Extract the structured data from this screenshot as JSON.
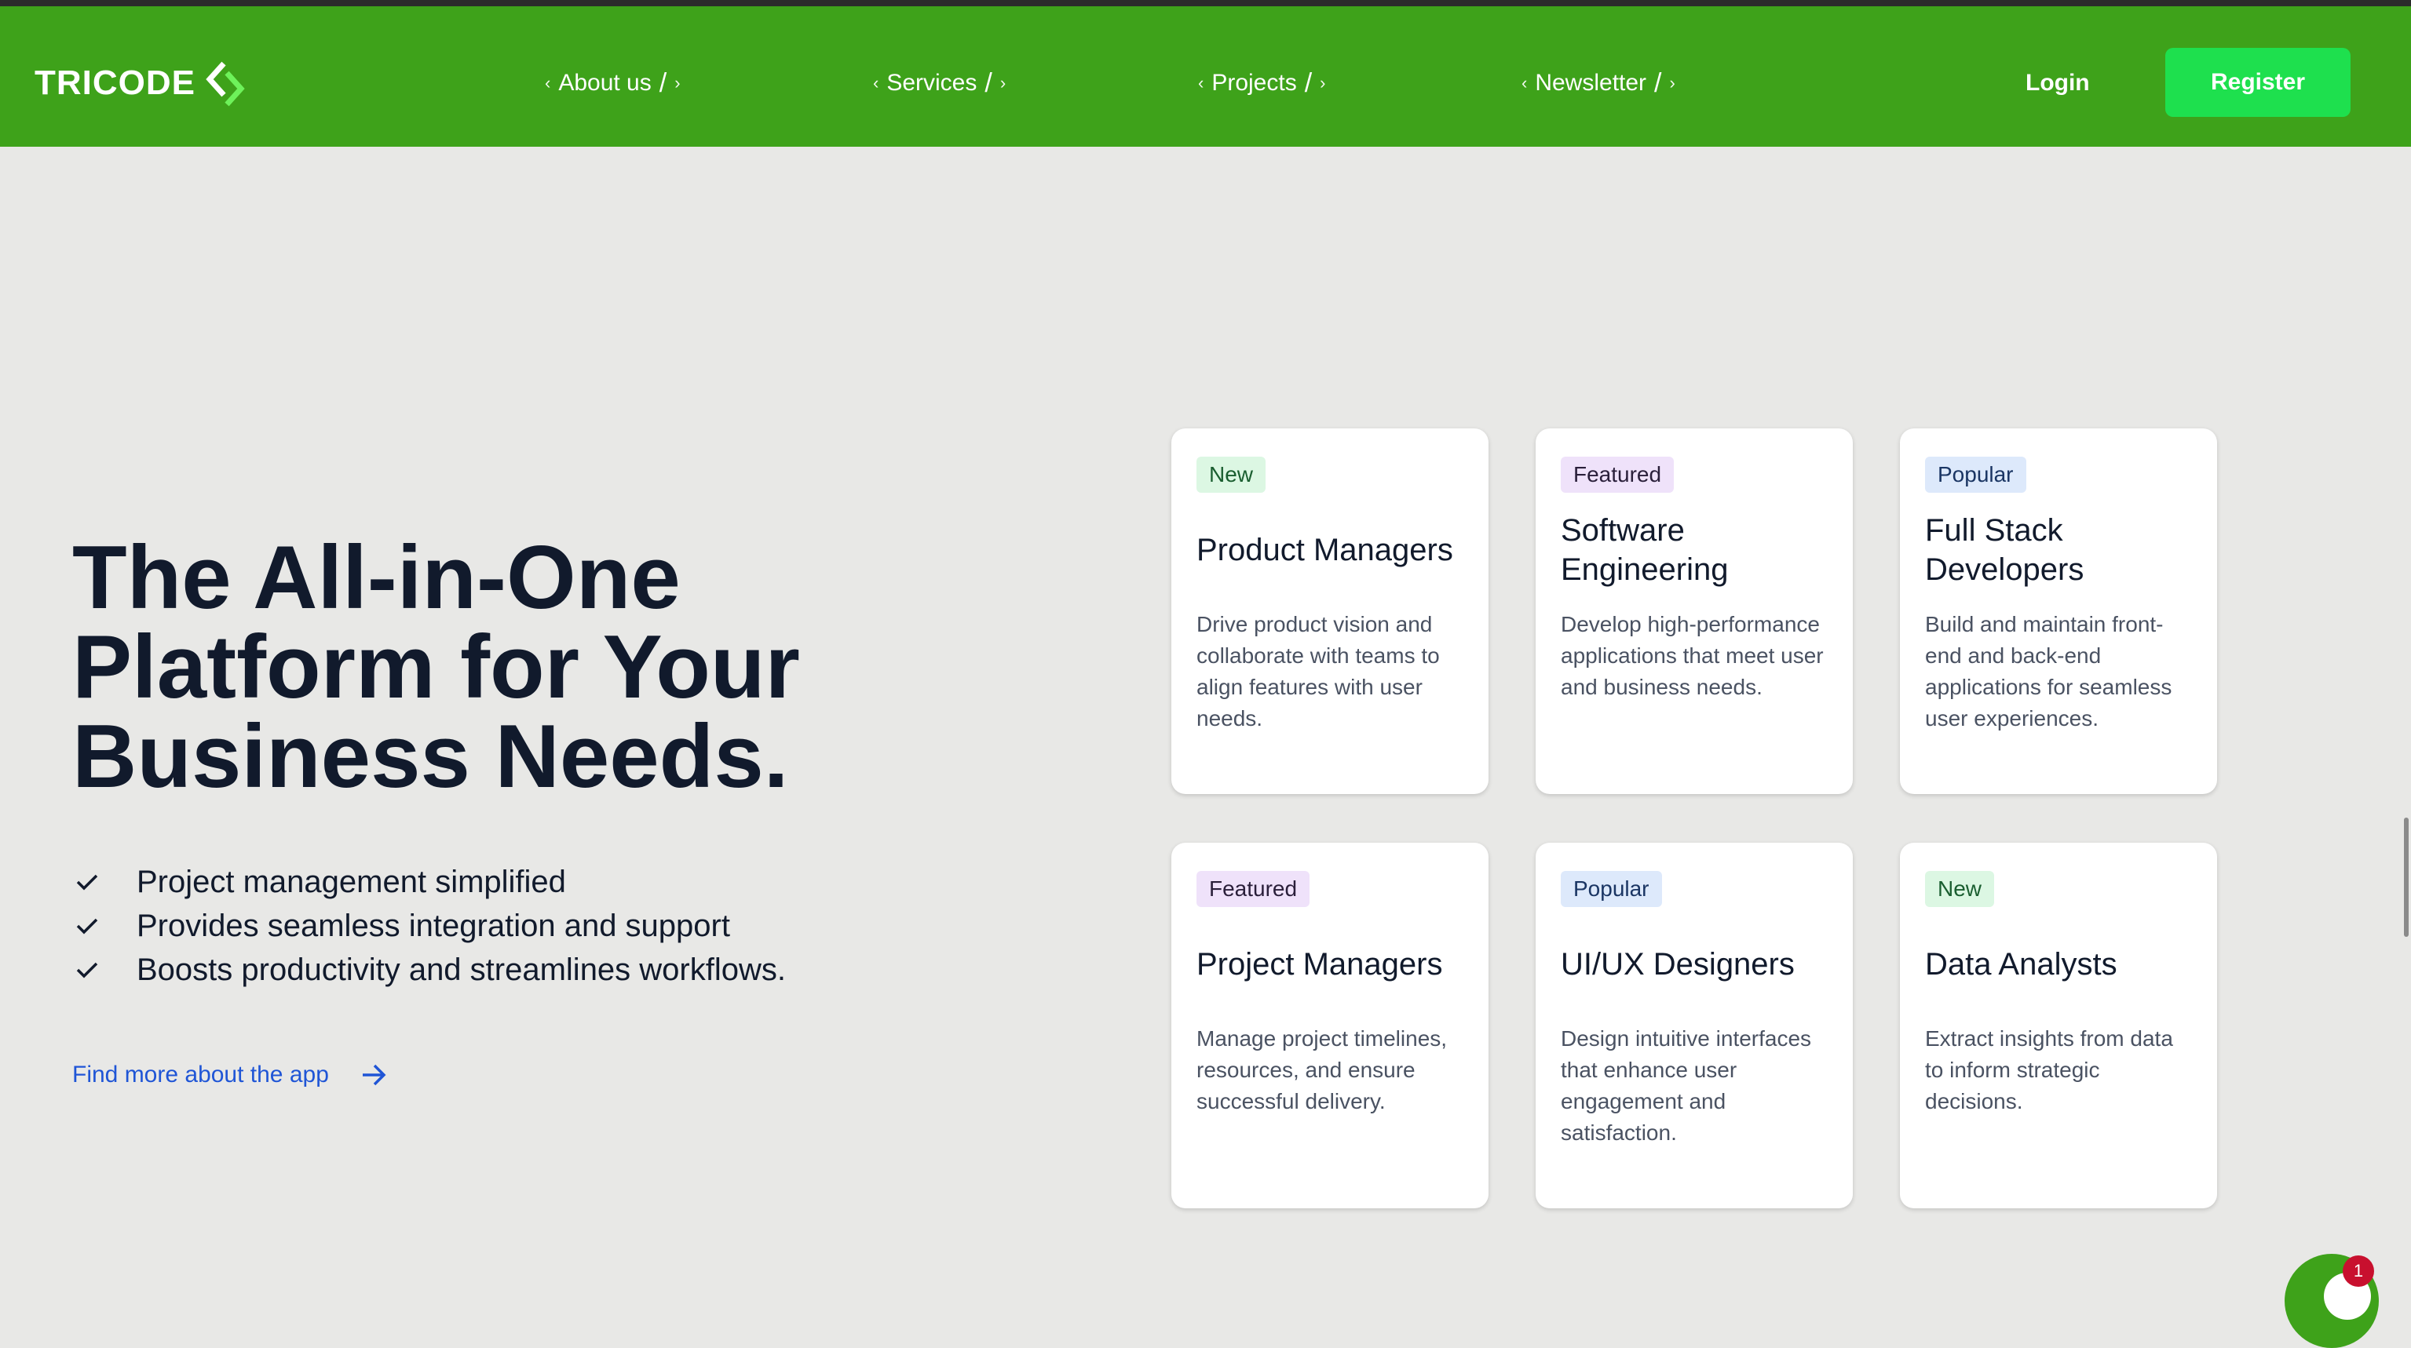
{
  "brand": {
    "name": "TRICODE",
    "color": "#3ea21a",
    "accent": "#1ee04e"
  },
  "nav": {
    "items": [
      {
        "label": "About us",
        "open": "‹",
        "slash": "/",
        "close": "›"
      },
      {
        "label": "Services",
        "open": "‹",
        "slash": "/",
        "close": "›"
      },
      {
        "label": "Projects",
        "open": "‹",
        "slash": "/",
        "close": "›"
      },
      {
        "label": "Newsletter",
        "open": "‹",
        "slash": "/",
        "close": "›"
      }
    ],
    "login": "Login",
    "register": "Register"
  },
  "hero": {
    "title_lines": [
      "The All-in-One",
      "Platform for Your",
      "Business Needs."
    ],
    "features": [
      "Project management simplified",
      "Provides seamless integration and support",
      "Boosts productivity and streamlines workflows."
    ],
    "link": "Find more about the app"
  },
  "cards": [
    {
      "badge": "New",
      "title": "Product Managers",
      "desc": "Drive product vision and collaborate with teams to align features with user needs."
    },
    {
      "badge": "Featured",
      "title": "Software Engineering",
      "desc": "Develop high-performance applications that meet user and business needs."
    },
    {
      "badge": "Popular",
      "title": "Full Stack Developers",
      "desc": "Build and maintain front-end and back-end applications for seamless user experiences."
    },
    {
      "badge": "Featured",
      "title": "Project Managers",
      "desc": "Manage project timelines, resources, and ensure successful delivery."
    },
    {
      "badge": "Popular",
      "title": "UI/UX Designers",
      "desc": "Design intuitive interfaces that enhance user engagement and satisfaction."
    },
    {
      "badge": "New",
      "title": "Data Analysts",
      "desc": "Extract insights from data to inform strategic decisions."
    }
  ],
  "chat": {
    "notification_count": "1"
  },
  "icons": {
    "logo": "logo-chevron-icon",
    "check": "check-icon",
    "arrow": "arrow-right-icon",
    "chat": "chat-icon"
  }
}
